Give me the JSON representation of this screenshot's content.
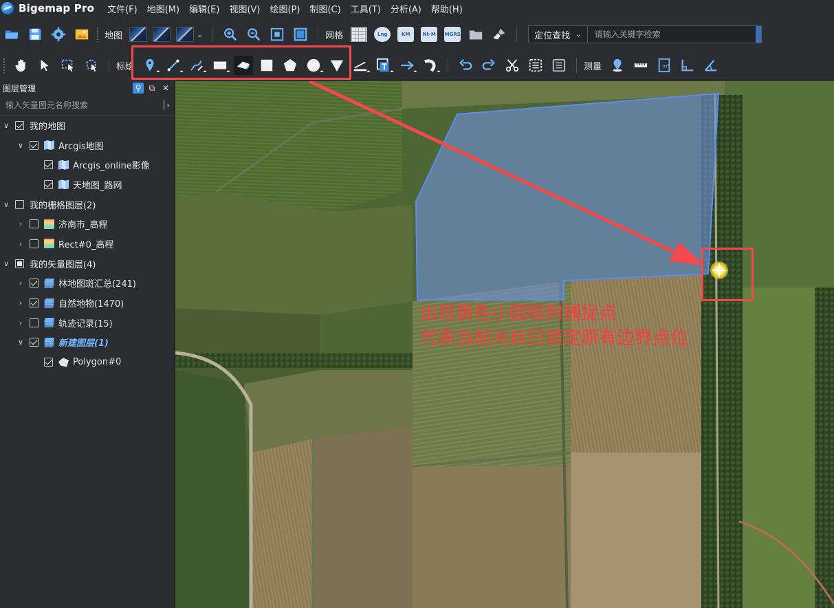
{
  "app": {
    "title": "Bigemap Pro"
  },
  "menu": [
    "文件(F)",
    "地图(M)",
    "编辑(E)",
    "视图(V)",
    "绘图(P)",
    "制图(C)",
    "工具(T)",
    "分析(A)",
    "帮助(H)"
  ],
  "toolbar1": {
    "map_label": "地图",
    "grid_label": "网格",
    "grid_badges": [
      "Lng",
      "KM",
      "Nt-M",
      "MGRS"
    ],
    "locate_mode": "定位查找",
    "search_placeholder": "请输入关键字检索"
  },
  "toolbar2": {
    "draw_label": "标绘",
    "measure_label": "测量"
  },
  "layer_panel": {
    "title": "图层管理",
    "search_placeholder": "输入矢量图元名称搜索",
    "tree": [
      {
        "label": "我的地图",
        "level": 0,
        "arrow": "down",
        "check": "on",
        "icon": "none"
      },
      {
        "label": "Arcgis地图",
        "level": 1,
        "arrow": "down",
        "check": "on",
        "icon": "map"
      },
      {
        "label": "Arcgis_online影像",
        "level": 2,
        "arrow": "none",
        "check": "on",
        "icon": "map"
      },
      {
        "label": "天地图_路网",
        "level": 2,
        "arrow": "none",
        "check": "on",
        "icon": "map"
      },
      {
        "label": "我的栅格图层(2)",
        "level": 0,
        "arrow": "down",
        "check": "off",
        "icon": "none"
      },
      {
        "label": "济南市_高程",
        "level": 1,
        "arrow": "right",
        "check": "off",
        "icon": "raster"
      },
      {
        "label": "Rect#0_高程",
        "level": 1,
        "arrow": "right",
        "check": "off",
        "icon": "raster"
      },
      {
        "label": "我的矢量图层(4)",
        "level": 0,
        "arrow": "down",
        "check": "part",
        "icon": "none"
      },
      {
        "label": "林地图斑汇总(241)",
        "level": 1,
        "arrow": "right",
        "check": "on",
        "icon": "stack"
      },
      {
        "label": "自然地物(1470)",
        "level": 1,
        "arrow": "right",
        "check": "on",
        "icon": "stack"
      },
      {
        "label": "轨迹记录(15)",
        "level": 1,
        "arrow": "right",
        "check": "off",
        "icon": "stack"
      },
      {
        "label": "新建图层(1)",
        "level": 1,
        "arrow": "down",
        "check": "on",
        "icon": "stack",
        "active": true
      },
      {
        "label": "Polygon#0",
        "level": 2,
        "arrow": "none",
        "check": "on",
        "icon": "poly"
      }
    ]
  },
  "map": {
    "annotation_lines": [
      "出现黄色小圆吸附捕捉点",
      "代表当前光标已锁定原有边界点位"
    ],
    "annotation_color": "#ff3b3b",
    "polygon_fill": "#6f8fd8",
    "snap_point_color": "#f3d533"
  },
  "colors": {
    "ui_background": "#2b2d31",
    "highlight_red": "#f04a4a",
    "accent_blue": "#3a8ee6"
  }
}
